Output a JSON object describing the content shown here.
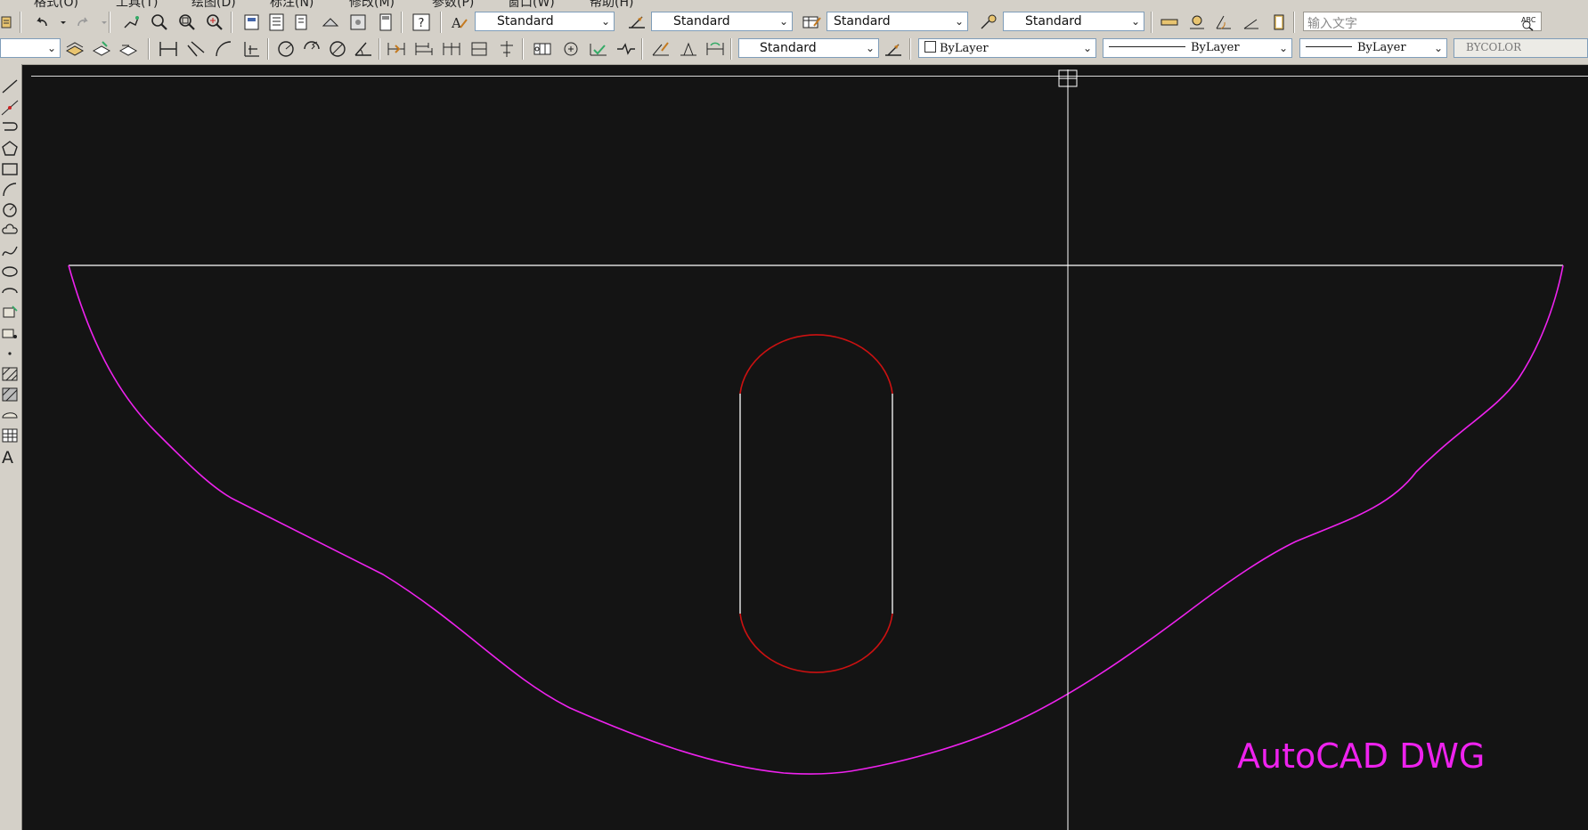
{
  "menu": {
    "items": [
      "格式(O)",
      "工具(T)",
      "绘图(D)",
      "标注(N)",
      "修改(M)",
      "参数(P)",
      "窗口(W)",
      "帮助(H)"
    ]
  },
  "styles_toolbar": {
    "text_style": "Standard",
    "dim_style": "Standard",
    "table_style": "Standard",
    "multileader_style": "Standard"
  },
  "search": {
    "placeholder": "输入文字"
  },
  "dim_toolbar": {
    "dim_style": "Standard"
  },
  "properties": {
    "color": "ByLayer",
    "linetype": "ByLayer",
    "lineweight": "ByLayer",
    "plot_style": "BYCOLOR"
  },
  "left_toolbar": {
    "text_tool_glyph": "A"
  },
  "drawing": {
    "watermark": "AutoCAD DWG",
    "colors": {
      "background": "#141414",
      "outline": "#ee22ee",
      "slot_arcs": "#cc1111",
      "slot_lines": "#ffffff",
      "top_line": "#ffffff",
      "crosshair": "#ffffff"
    }
  }
}
